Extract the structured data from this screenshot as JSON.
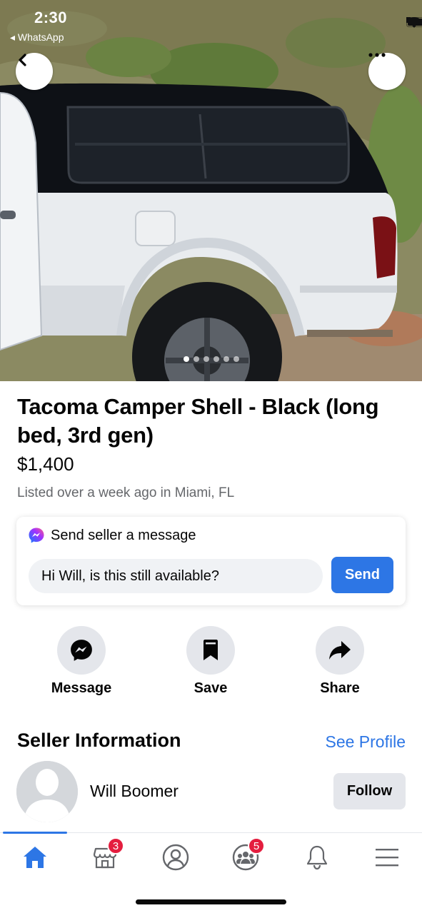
{
  "status_bar": {
    "time": "2:30",
    "back_app": "◂ WhatsApp"
  },
  "hero": {
    "photo_count": 6,
    "active_photo_index": 0
  },
  "listing": {
    "title": "Tacoma Camper Shell - Black (long bed, 3rd gen)",
    "price": "$1,400",
    "listed": "Listed over a week ago in Miami, FL"
  },
  "message_card": {
    "header": "Send seller a message",
    "input_value": "Hi Will, is this still available?",
    "send_label": "Send"
  },
  "actions": [
    {
      "label": "Message",
      "icon": "messenger-icon"
    },
    {
      "label": "Save",
      "icon": "bookmark-icon"
    },
    {
      "label": "Share",
      "icon": "share-arrow-icon"
    }
  ],
  "seller": {
    "section_title": "Seller Information",
    "see_profile": "See Profile",
    "name": "Will Boomer",
    "follow_label": "Follow"
  },
  "tabbar": {
    "tabs": [
      {
        "icon": "home-icon",
        "active": true
      },
      {
        "icon": "marketplace-icon",
        "badge": "3"
      },
      {
        "icon": "profile-icon"
      },
      {
        "icon": "groups-icon",
        "badge": "5"
      },
      {
        "icon": "bell-icon"
      },
      {
        "icon": "menu-icon"
      }
    ]
  },
  "colors": {
    "accent": "#2d76e5",
    "badge": "#e41e3f",
    "muted_text": "#65676b",
    "chip_bg": "#e4e6eb"
  }
}
